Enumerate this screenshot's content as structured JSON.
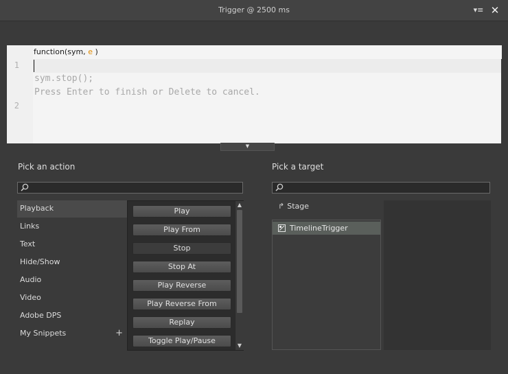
{
  "window": {
    "title": "Trigger @ 2500 ms",
    "menu_icon": "panel-menu-icon",
    "close_icon": "close-icon"
  },
  "editor": {
    "signature_prefix": "function(sym, ",
    "signature_param": "e",
    "signature_suffix": " )",
    "line_numbers": [
      "1",
      "2"
    ],
    "lines": [
      "sym.stop();",
      "Press Enter to finish or Delete to cancel."
    ]
  },
  "pick_action": {
    "title": "Pick an action",
    "search_placeholder": "",
    "categories": [
      {
        "label": "Playback",
        "selected": true
      },
      {
        "label": "Links"
      },
      {
        "label": "Text"
      },
      {
        "label": "Hide/Show"
      },
      {
        "label": "Audio"
      },
      {
        "label": "Video"
      },
      {
        "label": "Adobe DPS"
      },
      {
        "label": "My Snippets"
      }
    ],
    "actions": [
      "Play",
      "Play From",
      "Stop",
      "Stop At",
      "Play Reverse",
      "Play Reverse From",
      "Replay",
      "Toggle Play/Pause"
    ]
  },
  "pick_target": {
    "title": "Pick a target",
    "search_placeholder": "",
    "stage_label": "Stage",
    "items": [
      "TimelineTrigger"
    ]
  },
  "colors": {
    "accent_selected": "#5a5f5b",
    "editor_bg": "#f4f4f4",
    "param_color": "#e08a00"
  }
}
